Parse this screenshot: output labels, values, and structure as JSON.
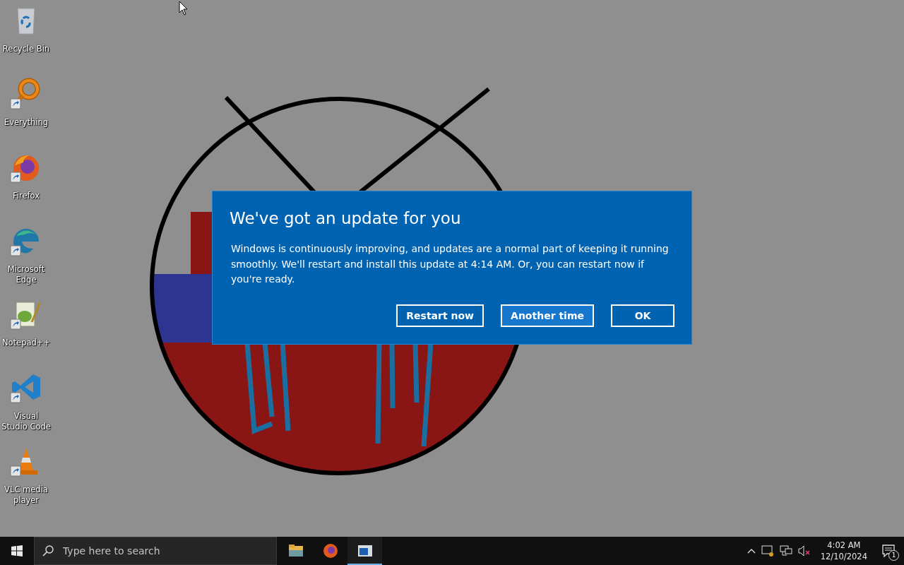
{
  "desktop": {
    "wallpaper": {
      "kind": "drawing"
    },
    "icons": [
      {
        "label": "Recycle Bin",
        "kind": "recycle",
        "shortcut": false
      },
      {
        "label": "Everything",
        "kind": "search",
        "shortcut": true
      },
      {
        "label": "Firefox",
        "kind": "firefox",
        "shortcut": true
      },
      {
        "label": "Microsoft Edge",
        "kind": "edge",
        "shortcut": true
      },
      {
        "label": "Notepad++",
        "kind": "notepad",
        "shortcut": true
      },
      {
        "label": "Visual Studio Code",
        "kind": "vscode",
        "shortcut": true
      },
      {
        "label": "VLC media player",
        "kind": "vlc",
        "shortcut": true
      }
    ]
  },
  "dialog": {
    "title": "We've got an update for you",
    "message": "Windows is continuously improving, and updates are a normal part of keeping it running smoothly. We'll restart and install this update at 4:14 AM. Or, you can restart now if you're ready.",
    "buttons": [
      {
        "label": "Restart now",
        "focused": false
      },
      {
        "label": "Another time",
        "focused": true
      },
      {
        "label": "OK",
        "focused": false
      }
    ]
  },
  "taskbar": {
    "search": {
      "placeholder": "Type here to search"
    },
    "apps": [
      {
        "kind": "explorer",
        "active": false
      },
      {
        "kind": "firefox",
        "active": false
      },
      {
        "kind": "window",
        "active": true
      }
    ],
    "tray": {
      "time": "4:02 AM",
      "date": "12/10/2024",
      "notifications": "1"
    }
  }
}
